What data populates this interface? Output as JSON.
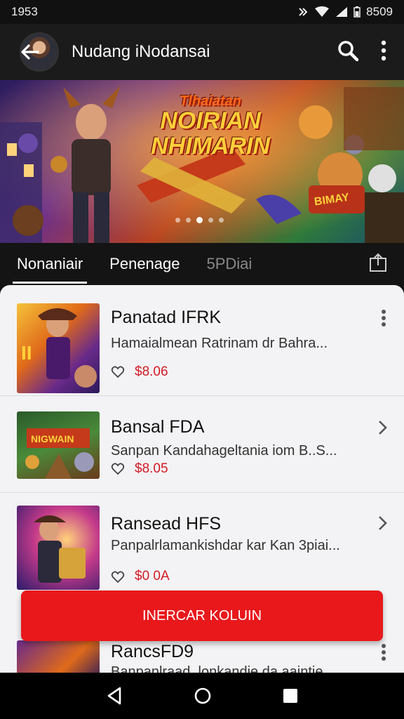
{
  "status_bar": {
    "time": "1953",
    "battery_text": "8509"
  },
  "app_bar": {
    "title": "Nudang iNodansai",
    "icons": [
      "back-arrow-icon",
      "search-icon",
      "more-vert-icon"
    ]
  },
  "banner": {
    "title_line1": "Tlhaiatan",
    "title_line2": "NOIRIAN",
    "title_line3": "NHIMARIN",
    "sign_text": "BIMAY",
    "carousel_pages": 5,
    "carousel_active": 3
  },
  "tabs": [
    {
      "label": "Nonaniair"
    },
    {
      "label": "Penenage"
    },
    {
      "label": "5PDiai"
    }
  ],
  "items": [
    {
      "title": "Panatad IFRK",
      "desc": "Hamaialmean Ratrinam dr  Bahra...",
      "price": "$8.06",
      "action": "more-vert-icon"
    },
    {
      "title": "Bansal FDA",
      "desc": "Sanpan Kandahageltania iom B..S...",
      "price": "$8.05",
      "action": "chevron-right-icon"
    },
    {
      "title": "Ransead HFS",
      "desc": "Panpalrlamankishdar kar Kan 3piai...",
      "price": "$0 0A",
      "action": "chevron-right-icon"
    },
    {
      "title": "RancsFD9",
      "desc": "Banpanlraad ,lonkandie da aaintie",
      "price": "",
      "action": "more-vert-icon"
    }
  ],
  "cta": {
    "label": "INERCAR KOLUIN"
  },
  "colors": {
    "accent": "#e8181b",
    "price": "#d21b24"
  }
}
